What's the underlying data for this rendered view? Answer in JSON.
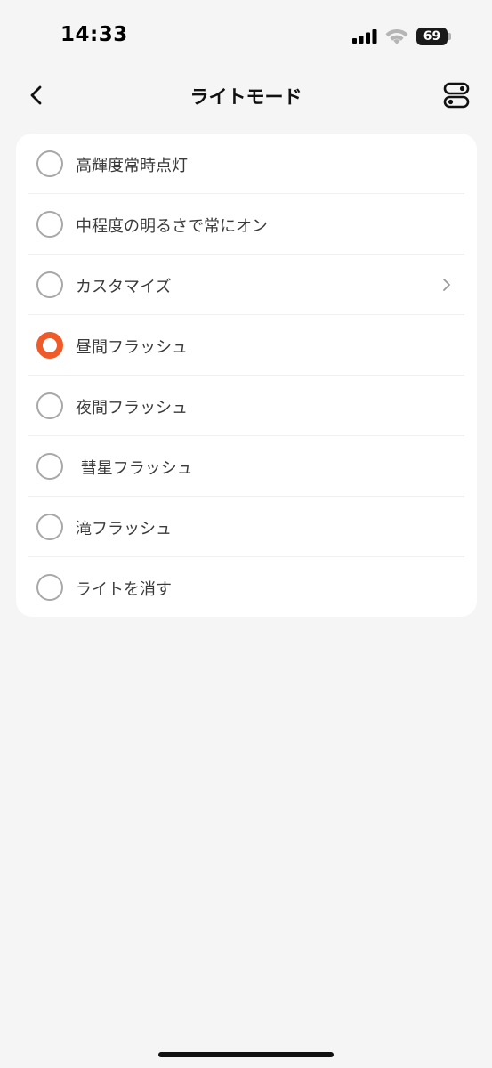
{
  "status_bar": {
    "time": "14:33",
    "battery_level": "69"
  },
  "header": {
    "title": "ライトモード",
    "back_icon": "chevron-left-icon",
    "right_icon": "toggles-icon"
  },
  "options": [
    {
      "label": "高輝度常時点灯",
      "selected": false,
      "has_chevron": false
    },
    {
      "label": "中程度の明るさで常にオン",
      "selected": false,
      "has_chevron": false
    },
    {
      "label": "カスタマイズ",
      "selected": false,
      "has_chevron": true
    },
    {
      "label": "昼間フラッシュ",
      "selected": true,
      "has_chevron": false
    },
    {
      "label": "夜間フラッシュ",
      "selected": false,
      "has_chevron": false
    },
    {
      "label": " 彗星フラッシュ",
      "selected": false,
      "has_chevron": false
    },
    {
      "label": "滝フラッシュ",
      "selected": false,
      "has_chevron": false
    },
    {
      "label": "ライトを消す",
      "selected": false,
      "has_chevron": false
    }
  ],
  "colors": {
    "accent": "#f05a28",
    "background": "#f5f5f5",
    "card": "#ffffff",
    "radio_border": "#a8a8a8"
  }
}
